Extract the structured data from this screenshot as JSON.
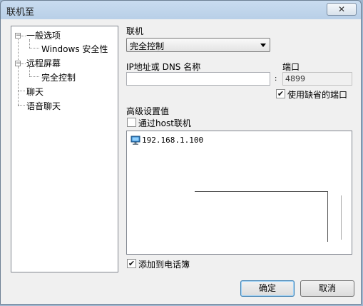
{
  "window": {
    "title": "联机至",
    "close_label": "✕"
  },
  "tree": {
    "items": [
      {
        "label": "一般选项",
        "level": 0,
        "expander": "−"
      },
      {
        "label": "Windows 安全性",
        "level": 1
      },
      {
        "label": "远程屏幕",
        "level": 0,
        "expander": "−"
      },
      {
        "label": "完全控制",
        "level": 1
      },
      {
        "label": "聊天",
        "level": 0
      },
      {
        "label": "语音聊天",
        "level": 0
      }
    ]
  },
  "connect": {
    "label": "联机",
    "selected": "完全控制"
  },
  "address": {
    "label": "IP地址或 DNS 名称",
    "value": ""
  },
  "port": {
    "label": "端口",
    "separator": ":",
    "value": "4899"
  },
  "default_port": {
    "label": "使用缺省的端口",
    "checked": true
  },
  "advanced": {
    "label": "高级设置值",
    "via_host_label": "通过host联机",
    "via_host_checked": false
  },
  "hosts": [
    {
      "address": "192.168.1.100",
      "icon": "computer-icon"
    }
  ],
  "phonebook": {
    "label": "添加到电话簿",
    "checked": true
  },
  "buttons": {
    "ok": "确定",
    "cancel": "取消"
  }
}
